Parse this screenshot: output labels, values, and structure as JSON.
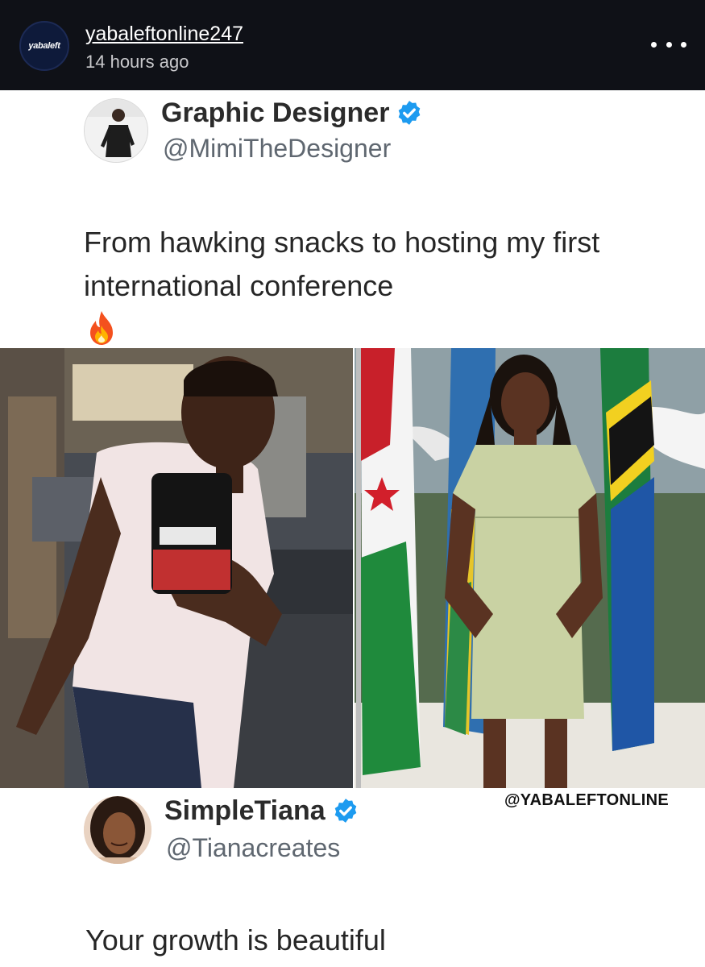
{
  "post": {
    "avatar_text": "yabaleft",
    "username": "yabaleftonline247",
    "time": "14 hours ago"
  },
  "tweet": {
    "name": "Graphic Designer",
    "handle": "@MimiTheDesigner",
    "text": "From hawking snacks to hosting my first international conference",
    "emoji_icon": "fire-icon"
  },
  "images": {
    "left": "selfie-before-photo",
    "right": "conference-after-photo",
    "watermark": "@YABALEFTONLINE"
  },
  "reply": {
    "name": "SimpleTiana",
    "handle": "@Tianacreates",
    "text": "Your growth is beautiful"
  },
  "colors": {
    "header_bg": "#0f1117",
    "verified_blue": "#1d9bf0",
    "text_dark": "#262626",
    "handle_gray": "#5f6770"
  }
}
